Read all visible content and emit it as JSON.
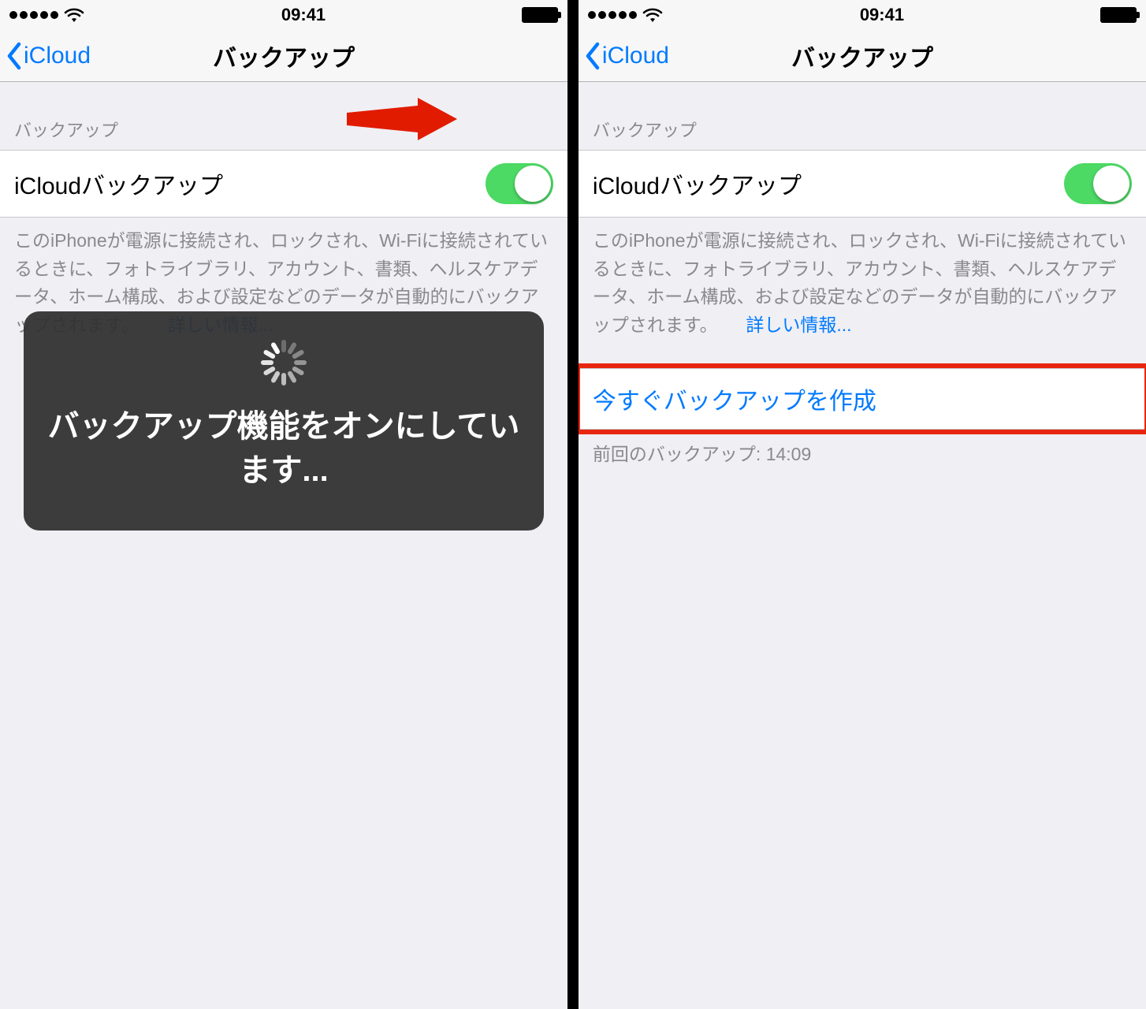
{
  "statusbar": {
    "time": "09:41"
  },
  "nav": {
    "back_label": "iCloud",
    "title": "バックアップ"
  },
  "section": {
    "header": "バックアップ",
    "toggle_label": "iCloudバックアップ"
  },
  "footer": {
    "description": "このiPhoneが電源に接続され、ロックされ、Wi-Fiに接続されているときに、フォトライブラリ、アカウント、書類、ヘルスケアデータ、ホーム構成、および設定などのデータが自動的にバックアップされます。",
    "link_label": "詳しい情報..."
  },
  "toast": {
    "message": "バックアップ機能をオンにしています..."
  },
  "action": {
    "backup_now": "今すぐバックアップを作成",
    "last_backup": "前回のバックアップ: 14:09"
  }
}
